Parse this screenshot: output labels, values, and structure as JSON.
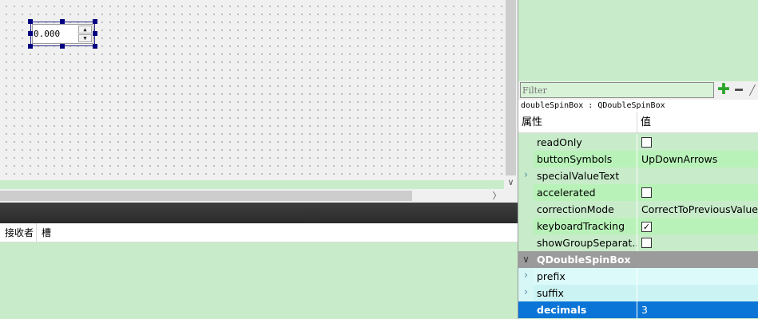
{
  "designer": {
    "spinbox_value": "0.000",
    "spin_up_glyph": "▲",
    "spin_down_glyph": "▼",
    "vscroll_arrow": "∨",
    "hscroll_arrow": "〉"
  },
  "signal_slot_panel": {
    "columns": [
      "接收者",
      "槽"
    ]
  },
  "property_editor": {
    "filter_placeholder": "Filter",
    "add_glyph": "✚",
    "remove_glyph": "━",
    "config_glyph": "╱",
    "object_label": "doubleSpinBox : QDoubleSpinBox",
    "header": {
      "property": "属性",
      "value": "值"
    },
    "rows": [
      {
        "name": "readOnly",
        "value": "",
        "checkbox": true,
        "checked": false,
        "expand": ""
      },
      {
        "name": "buttonSymbols",
        "value": "UpDownArrows",
        "expand": ""
      },
      {
        "name": "specialValueText",
        "value": "",
        "expand": "›"
      },
      {
        "name": "accelerated",
        "value": "",
        "checkbox": true,
        "checked": false,
        "expand": ""
      },
      {
        "name": "correctionMode",
        "value": "CorrectToPreviousValue",
        "expand": ""
      },
      {
        "name": "keyboardTracking",
        "value": "",
        "checkbox": true,
        "checked": true,
        "expand": ""
      },
      {
        "name": "showGroupSeparat...",
        "value": "",
        "checkbox": true,
        "checked": false,
        "expand": ""
      },
      {
        "name": "QDoubleSpinBox",
        "value": "",
        "group": true,
        "expand": "∨"
      },
      {
        "name": "prefix",
        "value": "",
        "expand": "›"
      },
      {
        "name": "suffix",
        "value": "",
        "expand": "›"
      },
      {
        "name": "decimals",
        "value": "3",
        "selected": true,
        "expand": ""
      }
    ],
    "check_glyph": "✓"
  },
  "colors": {
    "panel_bg": "#c8ecca",
    "selection": "#0a75d6",
    "group_row": "#9b9b9b",
    "widget_handle": "#000080"
  },
  "icons": [
    "plus-icon",
    "minus-icon",
    "wrench-icon",
    "chevron-right-icon",
    "chevron-down-icon",
    "checkmark-icon"
  ]
}
